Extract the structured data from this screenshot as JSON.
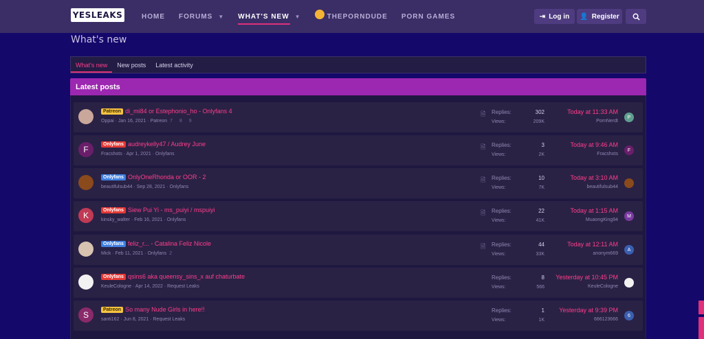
{
  "header": {
    "logo_text": "YESLEAKS",
    "nav": [
      {
        "label": "HOME"
      },
      {
        "label": "FORUMS"
      },
      {
        "label": "WHAT'S NEW"
      },
      {
        "label": "THEPORNDUDE"
      },
      {
        "label": "PORN GAMES"
      }
    ],
    "login_label": "Log in",
    "register_label": "Register"
  },
  "page": {
    "title": "What's new",
    "tabs": [
      "What's new",
      "New posts",
      "Latest activity"
    ],
    "block_title": "Latest posts"
  },
  "labels": {
    "replies": "Replies:",
    "views": "Views:"
  },
  "colors": {
    "accent": "#e0307a",
    "link": "#ff3d8a",
    "block_header": "#9c27b0",
    "background": "#14086b"
  },
  "threads": [
    {
      "avatar_letter": "",
      "avatar_color": "#c9a79a",
      "badge": "Patreon",
      "badge_type": "patreon",
      "title": "di_mi84 or Estephonio_ho - Onlyfans 4",
      "meta": "Oppai · Jan 16, 2021 · Patreon",
      "pages": "7 8 9",
      "replies": "302",
      "views": "209K",
      "last_time": "Today at 11:33 AM",
      "last_user": "PornNerdt",
      "last_avatar_letter": "P",
      "last_avatar_color": "#5f9e8f",
      "has_doc_icon": true
    },
    {
      "avatar_letter": "F",
      "avatar_color": "#6a1e6a",
      "badge": "Onlyfans",
      "badge_type": "onlyfans",
      "title": "audreykelly47 / Audrey June",
      "meta": "Fracshots · Apr 1, 2021 · Onlyfans",
      "pages": "",
      "replies": "3",
      "views": "2K",
      "last_time": "Today at 9:46 AM",
      "last_user": "Fracshots",
      "last_avatar_letter": "F",
      "last_avatar_color": "#6a1e6a",
      "has_doc_icon": true
    },
    {
      "avatar_letter": "",
      "avatar_color": "#8a4a1c",
      "badge": "Onlyfans",
      "badge_type": "onlyfans2",
      "title": "OnlyOneRhonda or OOR - 2",
      "meta": "beautifulsub44 · Sep 28, 2021 · Onlyfans",
      "pages": "",
      "replies": "10",
      "views": "7K",
      "last_time": "Today at 3:10 AM",
      "last_user": "beautifulsub44",
      "last_avatar_letter": "",
      "last_avatar_color": "#8a4a1c",
      "has_doc_icon": true
    },
    {
      "avatar_letter": "K",
      "avatar_color": "#c03a55",
      "badge": "Onlyfans",
      "badge_type": "onlyfans",
      "title": "Siew Pui Yi - ms_puiyi / mspuiyi",
      "meta": "kinsky_walter · Feb 16, 2021 · Onlyfans",
      "pages": "",
      "replies": "22",
      "views": "41K",
      "last_time": "Today at 1:15 AM",
      "last_user": "MuaongKing94",
      "last_avatar_letter": "M",
      "last_avatar_color": "#7a3aa0",
      "has_doc_icon": true
    },
    {
      "avatar_letter": "",
      "avatar_color": "#d8c3b0",
      "badge": "Onlyfans",
      "badge_type": "onlyfans2",
      "title": "feliz_r... - Catalina Feliz Nicole",
      "meta": "Mick · Feb 11, 2021 · Onlyfans",
      "pages": "2",
      "replies": "44",
      "views": "33K",
      "last_time": "Today at 12:11 AM",
      "last_user": "anonym669",
      "last_avatar_letter": "A",
      "last_avatar_color": "#3a5fb0",
      "has_doc_icon": true
    },
    {
      "avatar_letter": "",
      "avatar_color": "#f2f2f2",
      "badge": "Onlyfans",
      "badge_type": "onlyfans",
      "title": "qsins6 aka queensy_sins_x auf chaturbate",
      "meta": "KeuleCologne · Apr 14, 2022 · Request Leaks",
      "pages": "",
      "replies": "8",
      "views": "566",
      "last_time": "Yesterday at 10:45 PM",
      "last_user": "KeuleCologne",
      "last_avatar_letter": "",
      "last_avatar_color": "#f2f2f2",
      "has_doc_icon": false
    },
    {
      "avatar_letter": "S",
      "avatar_color": "#8a2a6a",
      "badge": "Patreon",
      "badge_type": "patreon",
      "title": "So many Nude Girls in here!!",
      "meta": "santi162 · Jun 8, 2021 · Request Leaks",
      "pages": "",
      "replies": "1",
      "views": "1K",
      "last_time": "Yesterday at 9:39 PM",
      "last_user": "666123666",
      "last_avatar_letter": "6",
      "last_avatar_color": "#3a5fb0",
      "has_doc_icon": false
    }
  ]
}
